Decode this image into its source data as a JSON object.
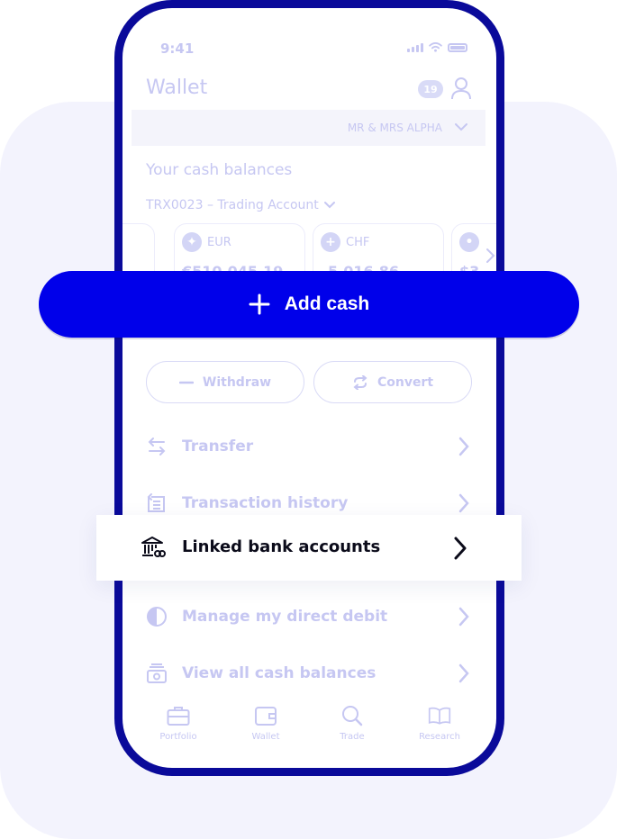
{
  "status_bar": {
    "time": "9:41"
  },
  "header": {
    "title": "Wallet",
    "notification_count": "19"
  },
  "account_selector": {
    "name": "MR & MRS ALPHA"
  },
  "cash_section": {
    "title": "Your cash balances",
    "trading_account": "TRX0023 – Trading Account",
    "cards": [
      {
        "currency": "EUR",
        "amount": "€510,045.19"
      },
      {
        "currency": "CHF",
        "amount": "5,016.86"
      },
      {
        "currency": "",
        "amount": "$3"
      }
    ]
  },
  "actions": {
    "add_cash": "Add cash",
    "withdraw": "Withdraw",
    "convert": "Convert"
  },
  "menu": [
    {
      "label": "Transfer",
      "icon": "transfer-icon"
    },
    {
      "label": "Transaction history",
      "icon": "history-icon"
    },
    {
      "label": "Linked bank accounts",
      "icon": "bank-link-icon"
    },
    {
      "label": "Manage my direct debit",
      "icon": "direct-debit-icon"
    },
    {
      "label": "View all cash balances",
      "icon": "cash-balances-icon"
    }
  ],
  "tabs": [
    {
      "label": "Portfolio",
      "icon": "briefcase-icon"
    },
    {
      "label": "Wallet",
      "icon": "wallet-icon"
    },
    {
      "label": "Trade",
      "icon": "search-icon"
    },
    {
      "label": "Research",
      "icon": "book-icon"
    }
  ],
  "colors": {
    "primary": "#0000ea",
    "frame": "#0a0a9a",
    "faded": "#c6c7f2",
    "background_card": "#f3f3fd"
  }
}
